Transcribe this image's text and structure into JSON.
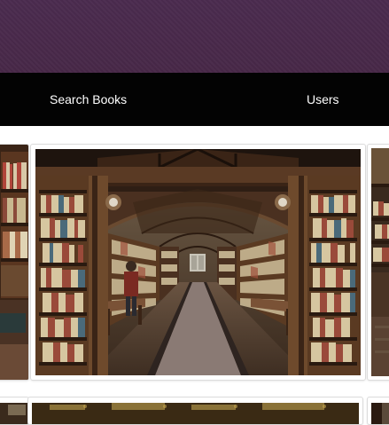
{
  "navbar": {
    "search_books_label": "Search Books",
    "users_label": "Users"
  },
  "colors": {
    "banner": "#4a2a4e",
    "navbar": "#030303",
    "nav_text": "#ffffff",
    "card_border": "#dcdcdc"
  },
  "gallery": {
    "row1": [
      {
        "image": "library-shelves-partial"
      },
      {
        "image": "library-hall-with-aisle"
      },
      {
        "image": "library-shelves-partial"
      }
    ],
    "row2": [
      {
        "image": "library-partial"
      },
      {
        "image": "library-partial"
      },
      {
        "image": "library-partial"
      }
    ]
  }
}
